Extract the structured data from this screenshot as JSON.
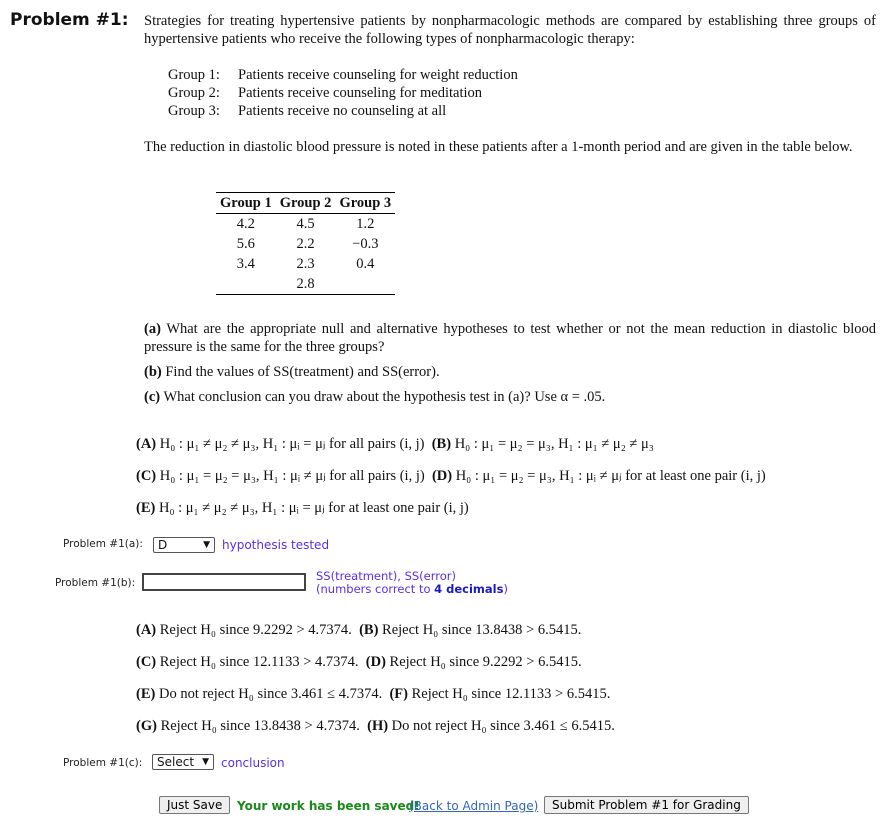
{
  "problem_title": "Problem #1:",
  "intro": "Strategies for treating hypertensive patients by nonpharmacologic methods are compared by establishing three groups of hypertensive patients who receive the following types of nonpharmacologic therapy:",
  "groups": [
    {
      "label": "Group 1:",
      "text": "Patients receive counseling for weight reduction"
    },
    {
      "label": "Group 2:",
      "text": "Patients receive counseling for meditation"
    },
    {
      "label": "Group 3:",
      "text": "Patients receive no counseling at all"
    }
  ],
  "para2": "The reduction in diastolic blood pressure is noted in these patients after a 1-month period and are given in the table below.",
  "table": {
    "headers": [
      "Group 1",
      "Group 2",
      "Group 3"
    ],
    "rows": [
      [
        "4.2",
        "4.5",
        "1.2"
      ],
      [
        "5.6",
        "2.2",
        "−0.3"
      ],
      [
        "3.4",
        "2.3",
        "0.4"
      ],
      [
        "",
        "2.8",
        ""
      ]
    ]
  },
  "questions": [
    {
      "tag": "(a)",
      "text": "What are the appropriate null and alternative hypotheses to test whether or not the mean reduction in diastolic blood pressure is the same for the three groups?"
    },
    {
      "tag": "(b)",
      "text": "Find the values of SS(treatment) and SS(error)."
    },
    {
      "tag": "(c)",
      "text": "What conclusion can you draw about the hypothesis test in (a)? Use α = .05."
    }
  ],
  "hyp_options": [
    [
      "(A)",
      "H₀ : μ₁ ≠ μ₂ ≠ μ₃,  H₁ : μᵢ = μⱼ  for all pairs (i, j)",
      "(B)",
      "H₀ : μ₁ = μ₂ = μ₃,  H₁ : μ₁ ≠ μ₂ ≠ μ₃"
    ],
    [
      "(C)",
      "H₀ : μ₁ = μ₂ = μ₃,  H₁ : μᵢ ≠ μⱼ  for all pairs (i, j)",
      "(D)",
      "H₀ : μ₁ = μ₂ = μ₃,  H₁ : μᵢ ≠ μⱼ  for at least one pair (i, j)"
    ],
    [
      "(E)",
      "H₀ : μ₁ ≠ μ₂ ≠ μ₃,  H₁ : μᵢ = μⱼ  for at least one pair (i, j)"
    ]
  ],
  "part_a": {
    "label": "Problem #1(a):",
    "value": "D",
    "hint": "hypothesis tested"
  },
  "part_b": {
    "label": "Problem #1(b):",
    "value": "",
    "hint1": "SS(treatment), SS(error)",
    "hint2a": "(numbers correct to ",
    "hint2b": "4 decimals",
    "hint2c": ")"
  },
  "concl_options": [
    [
      "(A)",
      "Reject H₀ since 9.2292 > 4.7374.",
      "(B)",
      "Reject H₀ since 13.8438 > 6.5415."
    ],
    [
      "(C)",
      "Reject H₀ since 12.1133 > 4.7374.",
      "(D)",
      "Reject H₀ since 9.2292 > 6.5415."
    ],
    [
      "(E)",
      "Do not reject H₀ since 3.461 ≤ 4.7374.",
      "(F)",
      "Reject H₀ since 12.1133 > 6.5415."
    ],
    [
      "(G)",
      "Reject H₀ since 13.8438 > 4.7374.",
      "(H)",
      "Do not reject H₀ since 3.461 ≤ 6.5415."
    ]
  ],
  "part_c": {
    "label": "Problem #1(c):",
    "value": "Select",
    "hint": "conclusion"
  },
  "footer": {
    "save": "Just Save",
    "saved": "Your work has been saved!",
    "back": "(Back to Admin Page)",
    "submit": "Submit Problem #1 for Grading"
  }
}
